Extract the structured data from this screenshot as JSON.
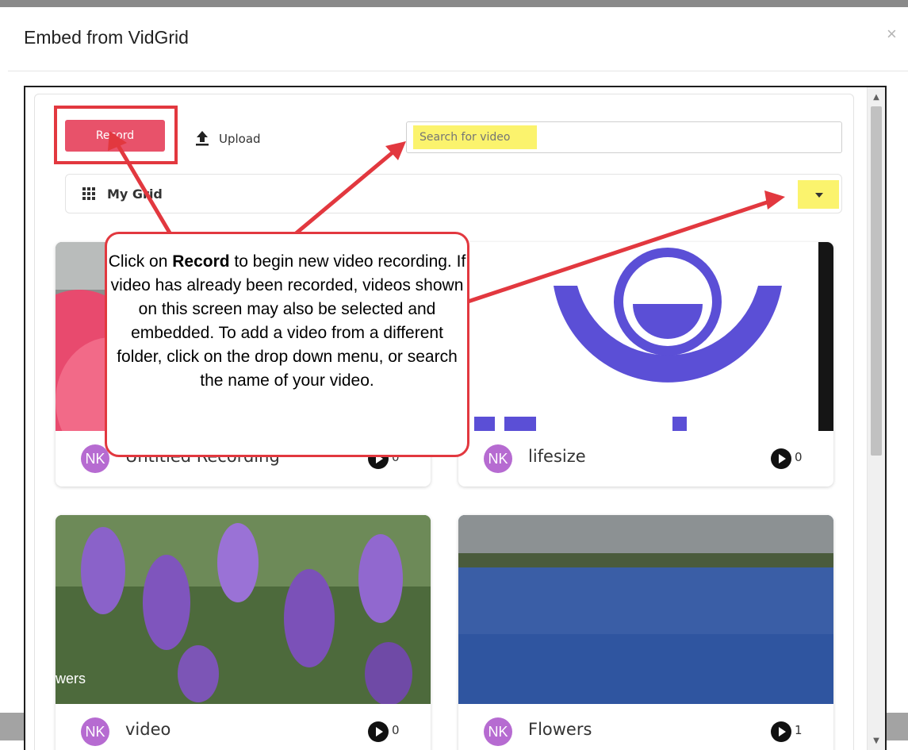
{
  "modal": {
    "title": "Embed from VidGrid",
    "close_label": "×"
  },
  "toolbar": {
    "record_label": "Record",
    "upload_label": "Upload",
    "search_placeholder": "Search for video"
  },
  "grid_select": {
    "label": "My Grid"
  },
  "videos": [
    {
      "title": "Untitled Recording",
      "avatar": "NK",
      "views": "0"
    },
    {
      "title": "lifesize",
      "avatar": "NK",
      "views": "0"
    },
    {
      "title": "video",
      "avatar": "NK",
      "views": "0",
      "overlay": "wers"
    },
    {
      "title": "Flowers",
      "avatar": "NK",
      "views": "1"
    }
  ],
  "callout": {
    "prefix": "Click on ",
    "bold": "Record",
    "rest": " to begin new video recording. If video has already been recorded, videos shown on this screen may also be selected and embedded. To add a video from a different folder, click on the drop down menu, or search the name of your video."
  },
  "colors": {
    "record": "#e8526a",
    "highlight": "#fbf36d",
    "annotation": "#e2383f",
    "avatar": "#b66bd1",
    "lifesize_logo": "#5b4fd6"
  }
}
